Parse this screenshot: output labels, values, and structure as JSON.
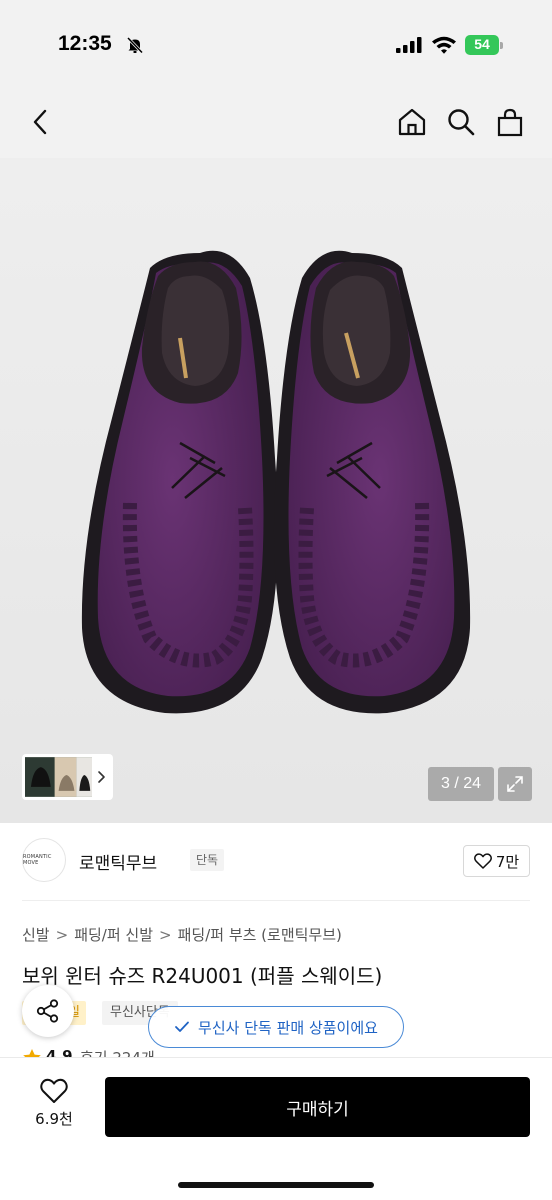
{
  "status_bar": {
    "time": "12:35",
    "battery": "54"
  },
  "nav": {
    "back_icon": "chevron-left-icon",
    "home_icon": "home-icon",
    "search_icon": "search-icon",
    "cart_icon": "shopping-bag-icon"
  },
  "gallery": {
    "counter": "3 / 24",
    "current": 3,
    "total": 24
  },
  "brand": {
    "logo_text": "ROMANTIC MOVE",
    "name": "로맨틱무브",
    "badge": "단독",
    "likes": "7만"
  },
  "breadcrumb": [
    "신발",
    "패딩/퍼 신발",
    "패딩/퍼 부츠 (로맨틱무브)"
  ],
  "breadcrumb_separator": ">",
  "product": {
    "title": "보위 윈터 슈즈 R24U001 (퍼플 스웨이드)",
    "tag_sale": "세일",
    "tag_exclusive": "무신사단독"
  },
  "toast": {
    "message": "무신사 단독 판매 상품이에요"
  },
  "rating": {
    "value": "4.9",
    "reviews": "후기 224개"
  },
  "bottom_bar": {
    "favorites": "6.9천",
    "buy_label": "구매하기"
  },
  "colors": {
    "accent_blue": "#1f63c4",
    "buy_button": "#000000",
    "battery": "#34c759",
    "sale_tag": "#d99500",
    "shoe_suede": "#5a2a63"
  }
}
